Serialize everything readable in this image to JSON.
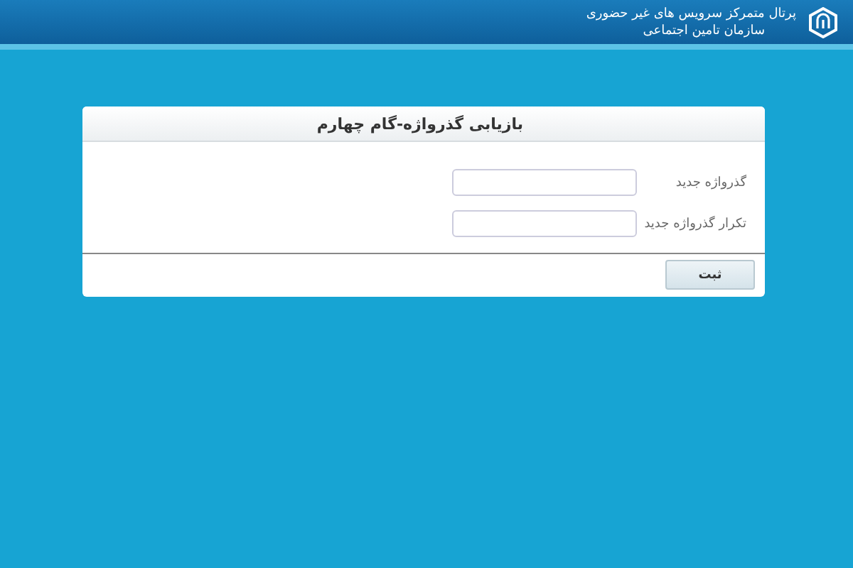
{
  "header": {
    "title": "پرتال متمرکز سرویس های غیر حضوری",
    "subtitle": "سازمان تامین اجتماعی"
  },
  "form": {
    "title": "بازیابی گذرواژه-گام چهارم",
    "fields": [
      {
        "label": "گذرواژه جدید"
      },
      {
        "label": "تکرار گذرواژه جدید"
      }
    ],
    "submit": "ثبت"
  }
}
